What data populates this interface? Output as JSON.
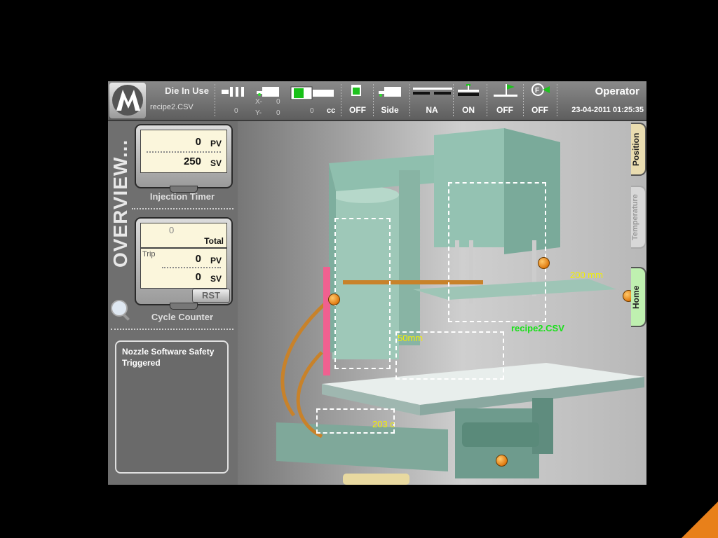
{
  "header": {
    "die_label": "Die In Use",
    "recipe_file": "recipe2.CSV",
    "pos_x_label": "X-",
    "pos_y_label": "Y-",
    "pos_x_value": "0",
    "pos_y_value": "0",
    "counter_value": "0",
    "volume_value": "0",
    "volume_unit": "cc",
    "statuses": [
      "OFF",
      "Side",
      "NA",
      "ON",
      "OFF",
      "OFF"
    ],
    "operator": "Operator",
    "datetime": "23-04-2011 01:25:35",
    "icons": [
      "syringe-icon",
      "nozzle-icon",
      "barrel-icon",
      "indicator-icon",
      "mold-side-icon",
      "platen-icon",
      "clamp-icon",
      "lever-icon",
      "filter-icon"
    ]
  },
  "left": {
    "overview_label": "OVERVIEW...",
    "injection_timer": {
      "pv": "0",
      "pv_unit": "PV",
      "sv": "250",
      "sv_unit": "SV",
      "caption": "Injection Timer"
    },
    "cycle_counter": {
      "total": "0",
      "total_label": "Total",
      "trip_label": "Trip",
      "pv": "0",
      "pv_unit": "PV",
      "sv": "0",
      "sv_unit": "SV",
      "reset_label": "RST",
      "caption": "Cycle Counter"
    },
    "message": "Nozzle Software Safety Triggered"
  },
  "main": {
    "tabs": [
      "Position",
      "Temperature",
      "Home"
    ],
    "label_200mm": "200 mm",
    "label_50mm": "50mm",
    "label_recipe": "recipe2.CSV",
    "label_temp": "203 c"
  },
  "colors": {
    "background": "#000000",
    "accent_orange": "#e8801a",
    "label_yellow": "#f2f000",
    "label_green": "#19e019",
    "machine_teal": "#8fbfae",
    "hose_orange": "#c8822a",
    "pink_bar": "#f06090"
  }
}
